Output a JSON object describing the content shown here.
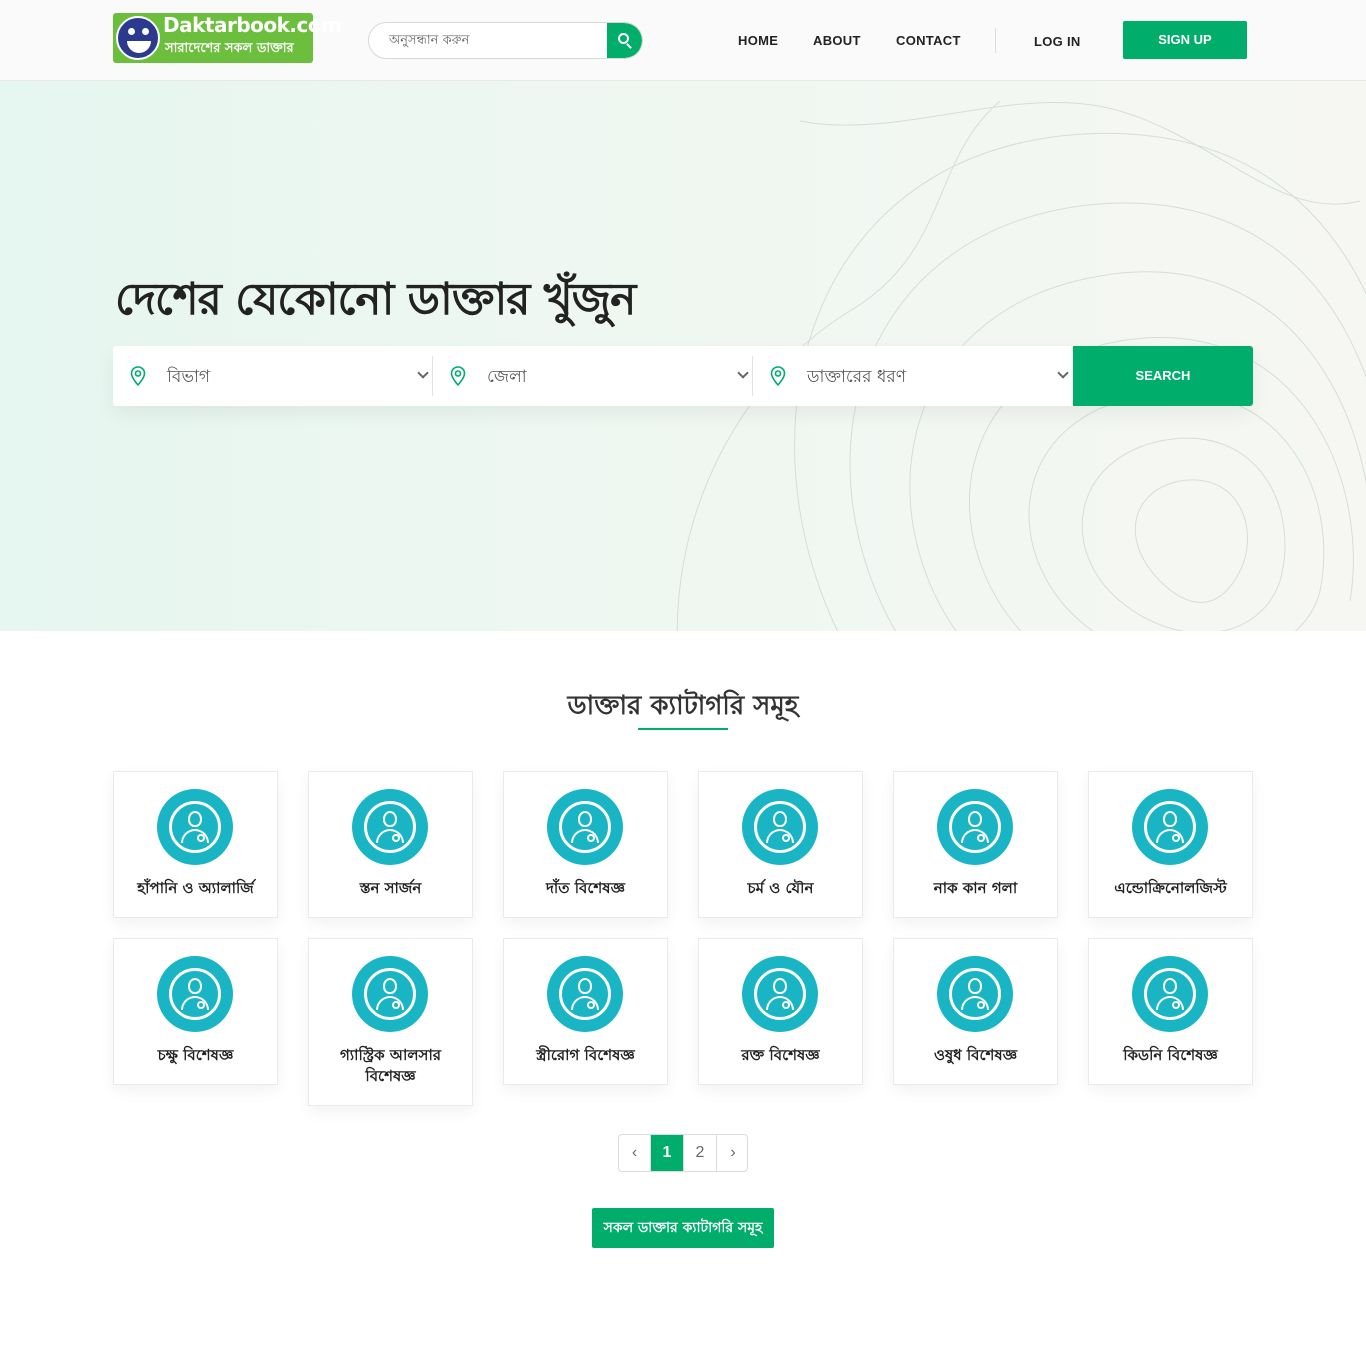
{
  "header": {
    "logo": {
      "brand": "Daktarbook.com",
      "tagline": "সারাদেশের সকল ডাক্তার"
    },
    "search": {
      "placeholder": "অনুসন্ধান করুন"
    },
    "nav": [
      {
        "label": "HOME"
      },
      {
        "label": "ABOUT"
      },
      {
        "label": "CONTACT"
      }
    ],
    "login_label": "LOG IN",
    "signup_label": "SIGN UP"
  },
  "hero": {
    "title": "দেশের যেকোনো ডাক্তার খুঁজুন",
    "filters": [
      {
        "label": "বিভাগ",
        "icon": "location-pin-icon"
      },
      {
        "label": "জেলা",
        "icon": "location-pin-icon"
      },
      {
        "label": "ডাক্তারের ধরণ",
        "icon": "location-pin-icon"
      }
    ],
    "search_label": "SEARCH"
  },
  "categories": {
    "title": "ডাক্তার ক্যাটাগরি সমূহ",
    "items": [
      {
        "name": "হাঁপানি ও অ্যালার্জি"
      },
      {
        "name": "স্তন সার্জন"
      },
      {
        "name": "দাঁত বিশেষজ্ঞ"
      },
      {
        "name": "চর্ম ও যৌন"
      },
      {
        "name": "নাক কান গলা"
      },
      {
        "name": "এন্ডোক্রিনোলজিস্ট"
      },
      {
        "name": "চক্ষু বিশেষজ্ঞ"
      },
      {
        "name": "গ্যাস্ট্রিক আলসার বিশেষজ্ঞ"
      },
      {
        "name": "স্ত্রীরোগ বিশেষজ্ঞ"
      },
      {
        "name": "রক্ত বিশেষজ্ঞ"
      },
      {
        "name": "ওষুধ বিশেষজ্ঞ"
      },
      {
        "name": "কিডনি বিশেষজ্ঞ"
      }
    ],
    "icon": "doctor-icon"
  },
  "pagination": {
    "prev": "‹",
    "pages": [
      "1",
      "2"
    ],
    "current": "1",
    "next": "›"
  },
  "all_categories_label": "সকল ডাক্তার ক্যাটাগরি সমূহ",
  "colors": {
    "accent": "#00ad6b",
    "icon_bg": "#1ab5c4"
  }
}
